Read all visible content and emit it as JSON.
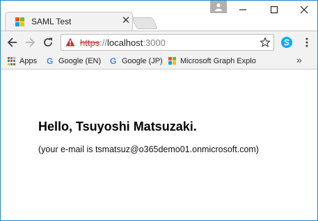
{
  "tab": {
    "title": "SAML Test",
    "close_glyph": "✕"
  },
  "window_controls": {
    "minimize": "minimize-icon",
    "maximize": "maximize-icon",
    "close": "close-icon"
  },
  "address_bar": {
    "scheme": "https",
    "separator": "://",
    "host": "localhost",
    "port": ":3000"
  },
  "bookmarks": [
    {
      "label": "Apps",
      "icon": "apps-grid-icon"
    },
    {
      "label": "Google (EN)",
      "icon": "google-icon"
    },
    {
      "label": "Google (JP)",
      "icon": "google-icon"
    },
    {
      "label": "Microsoft Graph Explo",
      "icon": "microsoft-icon"
    }
  ],
  "bookmarks_overflow": "»",
  "page": {
    "greeting": "Hello, Tsuyoshi Matsuzaki.",
    "email_line": "(your e-mail is tsmatsuz@o365demo01.onmicrosoft.com)"
  },
  "colors": {
    "ms_red": "#f25022",
    "ms_green": "#7fba00",
    "ms_blue": "#00a4ef",
    "ms_yellow": "#ffb900",
    "warning_red": "#c9322d",
    "skype_blue": "#00aff0",
    "window_border": "#1e86c7"
  }
}
